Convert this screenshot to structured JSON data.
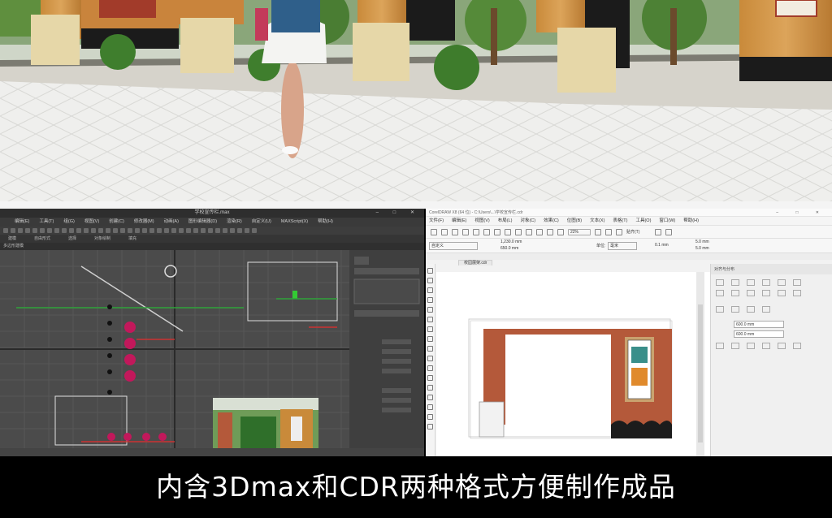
{
  "caption": "内含3Dmax和CDR两种格式方便制作成品",
  "colors": {
    "brand_brown": "#b4593a",
    "viewport_gray": "#4b4b4b",
    "caption_bg": "#000000",
    "caption_text": "#ffffff"
  },
  "max": {
    "title": "学校宣传栏.max",
    "menu": [
      "编辑(E)",
      "工具(T)",
      "组(G)",
      "视图(V)",
      "创建(C)",
      "修改器(M)",
      "动画(A)",
      "图形编辑器(D)",
      "渲染(R)",
      "自定义(U)",
      "MAXScript(X)",
      "帮助(H)"
    ],
    "ribbon": [
      "建模",
      "自由形式",
      "选择",
      "对象绘制",
      "填充"
    ],
    "subtitle": "多边形建模"
  },
  "cdr": {
    "title": "CorelDRAW X8 (64 位) - C:\\Users\\...\\学校宣传栏.cdr",
    "menu": [
      "文件(F)",
      "编辑(E)",
      "视图(V)",
      "布局(L)",
      "对象(C)",
      "效果(C)",
      "位图(B)",
      "文本(X)",
      "表格(T)",
      "工具(O)",
      "窗口(W)",
      "帮助(H)"
    ],
    "zoom": "22%",
    "preset": "自定义",
    "width": "1,230.0 mm",
    "height": "650.0 mm",
    "units_label": "单位:",
    "units": "毫米",
    "nudge": "0.1 mm",
    "size_x": "5.0 mm",
    "size_y": "5.0 mm",
    "snap": "贴齐(T)",
    "doc_tab": "校园展架.cdr",
    "docker_title": "对齐与分布",
    "docker_x": "600.0 mm",
    "docker_y": "600.0 mm"
  }
}
